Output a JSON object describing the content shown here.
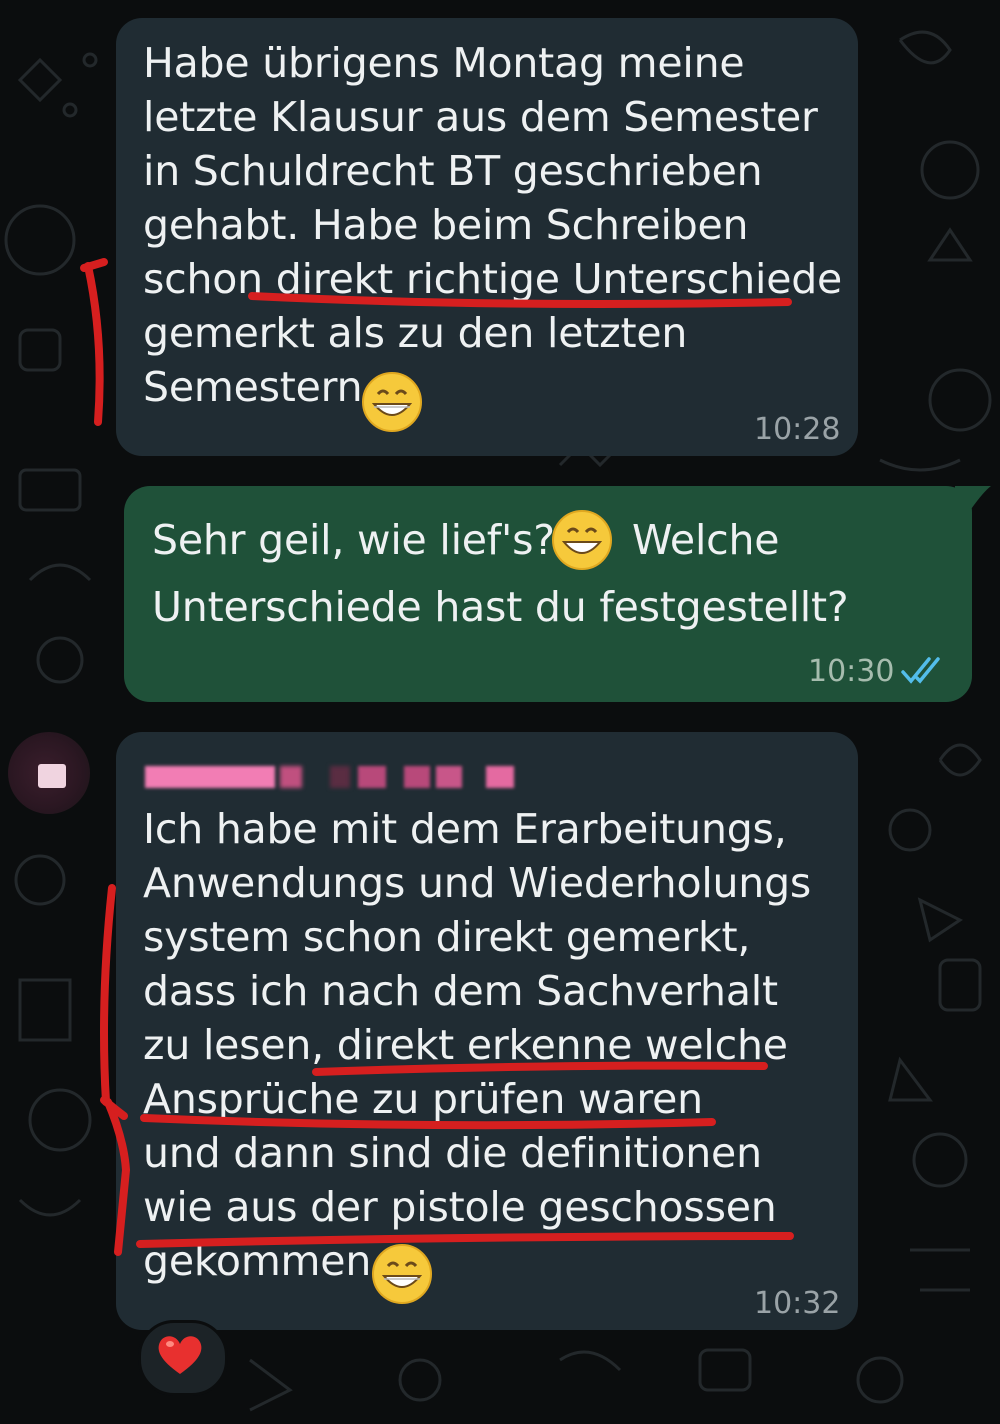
{
  "messages": [
    {
      "direction": "incoming",
      "text": "Habe übrigens Montag meine\nletzte Klausur aus dem Semester\nin Schuldrecht BT geschrieben\ngehabt. Habe beim Schreiben\nschon direkt richtige Unterschiede\ngemerkt als zu den letzten\nSemestern",
      "emoji": "grinning-face-icon",
      "time": "10:28"
    },
    {
      "direction": "outgoing",
      "text_line1": "Sehr geil, wie lief's?",
      "text_line1b": "Welche",
      "text_line2": "Unterschiede hast du festgestellt?",
      "emoji": "grinning-face-icon",
      "time": "10:30",
      "status": "read-double-check-icon"
    },
    {
      "direction": "incoming",
      "sender": "",
      "text": "Ich habe mit dem Erarbeitungs,\nAnwendungs und Wiederholungs\nsystem schon direkt gemerkt,\ndass ich nach dem Sachverhalt\nzu lesen, direkt erkenne welche\nAnsprüche zu prüfen waren\nund dann sind die definitionen\nwie aus der pistole geschossen\ngekommen",
      "emoji": "grinning-face-icon",
      "time": "10:32",
      "reaction": "heart-icon"
    }
  ],
  "colors": {
    "background": "#0b0d0e",
    "incoming_bubble": "#202c33",
    "outgoing_bubble": "#1f5139",
    "read_ticks": "#53bdeb",
    "annotation_red": "#d61f1f",
    "sender_name": "#f06292"
  }
}
